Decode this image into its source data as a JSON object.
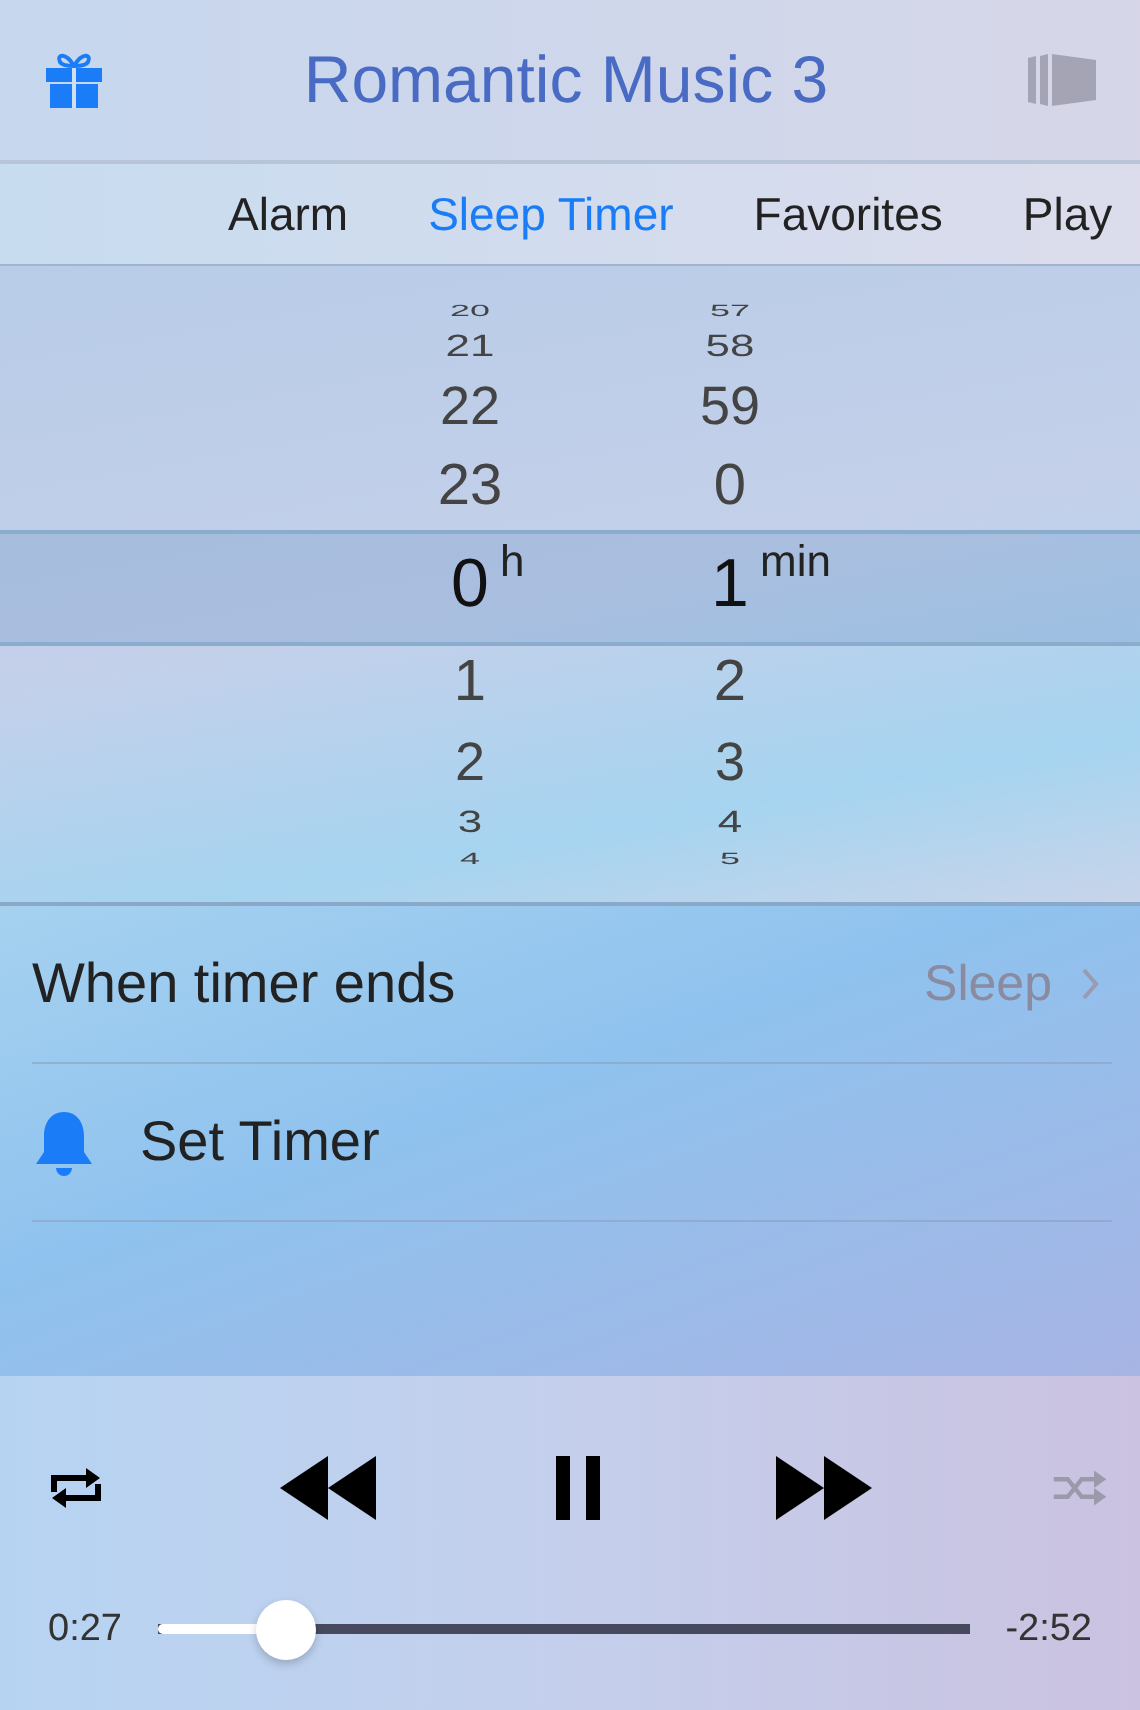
{
  "header": {
    "title": "Romantic Music 3"
  },
  "tabs": [
    {
      "label": "Alarm",
      "selected": false
    },
    {
      "label": "Sleep Timer",
      "selected": true
    },
    {
      "label": "Favorites",
      "selected": false
    },
    {
      "label": "Play",
      "selected": false
    }
  ],
  "picker": {
    "columns": [
      {
        "unit": "h",
        "items": [
          {
            "value": "20",
            "selected": false
          },
          {
            "value": "21",
            "selected": false
          },
          {
            "value": "22",
            "selected": false
          },
          {
            "value": "23",
            "selected": false
          },
          {
            "value": "0",
            "selected": true
          },
          {
            "value": "1",
            "selected": false
          },
          {
            "value": "2",
            "selected": false
          },
          {
            "value": "3",
            "selected": false
          },
          {
            "value": "4",
            "selected": false
          }
        ]
      },
      {
        "unit": "min",
        "items": [
          {
            "value": "57",
            "selected": false
          },
          {
            "value": "58",
            "selected": false
          },
          {
            "value": "59",
            "selected": false
          },
          {
            "value": "0",
            "selected": false
          },
          {
            "value": "1",
            "selected": true
          },
          {
            "value": "2",
            "selected": false
          },
          {
            "value": "3",
            "selected": false
          },
          {
            "value": "4",
            "selected": false
          },
          {
            "value": "5",
            "selected": false
          }
        ]
      }
    ]
  },
  "settings": [
    {
      "kind": "disclosure",
      "label": "When timer ends",
      "value": "Sleep"
    },
    {
      "kind": "action",
      "label": "Set Timer"
    }
  ],
  "player": {
    "repeat_on": true,
    "playing": true,
    "shuffle_on": false,
    "elapsed": "0:27",
    "remaining": "-2:52",
    "level": 0.157
  }
}
